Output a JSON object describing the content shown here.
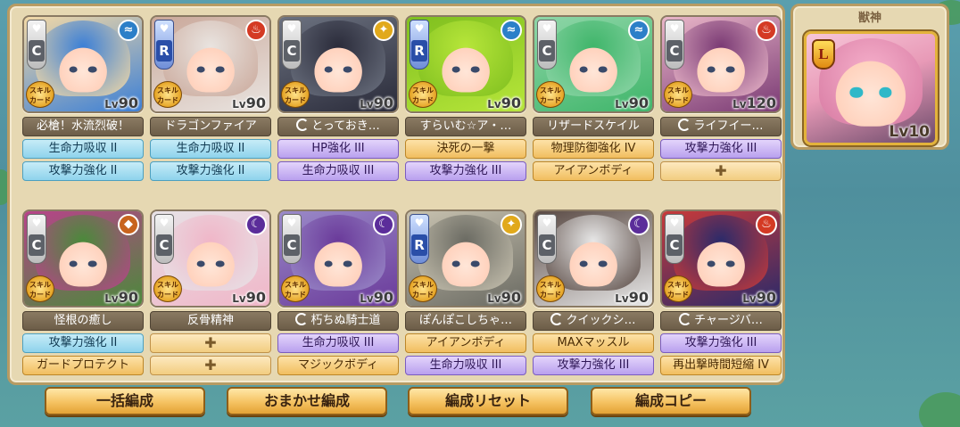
{
  "beast_panel": {
    "title": "獣神",
    "card": {
      "rank": "L",
      "level_prefix": "Lv",
      "level": "10"
    }
  },
  "units": [
    {
      "rarity": "C",
      "element": "water",
      "element_symbol": "≈",
      "element_color": "#2c7fc8",
      "level_prefix": "Lv",
      "level": "90",
      "name": "必槍！水流烈破！",
      "name_refresh": false,
      "colors": [
        "#3b7fd6",
        "#f3d9a6"
      ],
      "skills": [
        {
          "text": "生命力吸収 II",
          "style": "blue"
        },
        {
          "text": "攻撃力強化 II",
          "style": "blue"
        }
      ]
    },
    {
      "rarity": "R",
      "element": "fire",
      "element_symbol": "♨",
      "element_color": "#d43a24",
      "level_prefix": "Lv",
      "level": "90",
      "name": "ドラゴンファイア",
      "name_refresh": false,
      "colors": [
        "#e9e4e0",
        "#caa89a"
      ],
      "skills": [
        {
          "text": "生命力吸収 II",
          "style": "blue"
        },
        {
          "text": "攻撃力強化 II",
          "style": "blue"
        }
      ]
    },
    {
      "rarity": "C",
      "element": "light",
      "element_symbol": "✦",
      "element_color": "#e1a91b",
      "level_prefix": "Lv",
      "level": "90",
      "name": "とっておき…",
      "name_refresh": true,
      "colors": [
        "#2a2b3a",
        "#6c7280"
      ],
      "skills": [
        {
          "text": "HP強化 III",
          "style": "purple"
        },
        {
          "text": "生命力吸収 III",
          "style": "purple"
        }
      ]
    },
    {
      "rarity": "R",
      "element": "water",
      "element_symbol": "≈",
      "element_color": "#2c7fc8",
      "level_prefix": "Lv",
      "level": "90",
      "name": "すらいむ☆ア・…",
      "name_refresh": false,
      "colors": [
        "#b7e63a",
        "#7fbf1f"
      ],
      "skills": [
        {
          "text": "決死の一撃",
          "style": "gold"
        },
        {
          "text": "攻撃力強化 III",
          "style": "purple"
        }
      ]
    },
    {
      "rarity": "C",
      "element": "water",
      "element_symbol": "≈",
      "element_color": "#2c7fc8",
      "level_prefix": "Lv",
      "level": "90",
      "name": "リザードスケイル",
      "name_refresh": false,
      "colors": [
        "#3fb56a",
        "#8fd6a8"
      ],
      "skills": [
        {
          "text": "物理防御強化 IV",
          "style": "gold"
        },
        {
          "text": "アイアンボディ",
          "style": "gold"
        }
      ]
    },
    {
      "rarity": "C",
      "element": "fire",
      "element_symbol": "♨",
      "element_color": "#d43a24",
      "level_prefix": "Lv",
      "level": "120",
      "name": "ライフイー…",
      "name_refresh": true,
      "colors": [
        "#7a3a74",
        "#e9b6c8"
      ],
      "skills": [
        {
          "text": "攻撃力強化 III",
          "style": "purple"
        },
        {
          "text": "",
          "style": "empty"
        }
      ]
    },
    {
      "rarity": "C",
      "element": "earth",
      "element_symbol": "◆",
      "element_color": "#c8641e",
      "level_prefix": "Lv",
      "level": "90",
      "name": "怪根の癒し",
      "name_refresh": false,
      "colors": [
        "#4a8a3a",
        "#b8438a"
      ],
      "skills": [
        {
          "text": "攻撃力強化 II",
          "style": "blue"
        },
        {
          "text": "ガードプロテクト",
          "style": "gold"
        }
      ]
    },
    {
      "rarity": "C",
      "element": "dark",
      "element_symbol": "☾",
      "element_color": "#5b2d9a",
      "level_prefix": "Lv",
      "level": "90",
      "name": "反骨精神",
      "name_refresh": false,
      "colors": [
        "#f0b6c8",
        "#e7e2e6"
      ],
      "skills": [
        {
          "text": "",
          "style": "empty"
        },
        {
          "text": "",
          "style": "empty"
        }
      ]
    },
    {
      "rarity": "C",
      "element": "dark",
      "element_symbol": "☾",
      "element_color": "#5b2d9a",
      "level_prefix": "Lv",
      "level": "90",
      "name": "朽ちぬ騎士道",
      "name_refresh": true,
      "colors": [
        "#6a3a9a",
        "#9a8ac8"
      ],
      "skills": [
        {
          "text": "生命力吸収 III",
          "style": "purple"
        },
        {
          "text": "マジックボディ",
          "style": "gold"
        }
      ]
    },
    {
      "rarity": "R",
      "element": "light",
      "element_symbol": "✦",
      "element_color": "#e1a91b",
      "level_prefix": "Lv",
      "level": "90",
      "name": "ぽんぽこしちゃ…",
      "name_refresh": false,
      "colors": [
        "#6a6a62",
        "#c8c2b0"
      ],
      "skills": [
        {
          "text": "アイアンボディ",
          "style": "gold"
        },
        {
          "text": "生命力吸収 III",
          "style": "purple"
        }
      ]
    },
    {
      "rarity": "C",
      "element": "dark",
      "element_symbol": "☾",
      "element_color": "#5b2d9a",
      "level_prefix": "Lv",
      "level": "90",
      "name": "クイックシ…",
      "name_refresh": true,
      "colors": [
        "#e8e8e8",
        "#5a4a44"
      ],
      "skills": [
        {
          "text": "MAXマッスル",
          "style": "gold"
        },
        {
          "text": "攻撃力強化 III",
          "style": "purple"
        }
      ]
    },
    {
      "rarity": "C",
      "element": "fire",
      "element_symbol": "♨",
      "element_color": "#d43a24",
      "level_prefix": "Lv",
      "level": "90",
      "name": "チャージバ…",
      "name_refresh": true,
      "colors": [
        "#2a2a6a",
        "#c83a3a"
      ],
      "skills": [
        {
          "text": "攻撃力強化 III",
          "style": "purple"
        },
        {
          "text": "再出撃時間短縮 IV",
          "style": "gold"
        }
      ]
    }
  ],
  "skill_card_label": "スキルカード",
  "empty_slot_symbol": "✚",
  "buttons": [
    {
      "label": "一括編成"
    },
    {
      "label": "おまかせ編成"
    },
    {
      "label": "編成リセット"
    },
    {
      "label": "編成コピー"
    }
  ]
}
